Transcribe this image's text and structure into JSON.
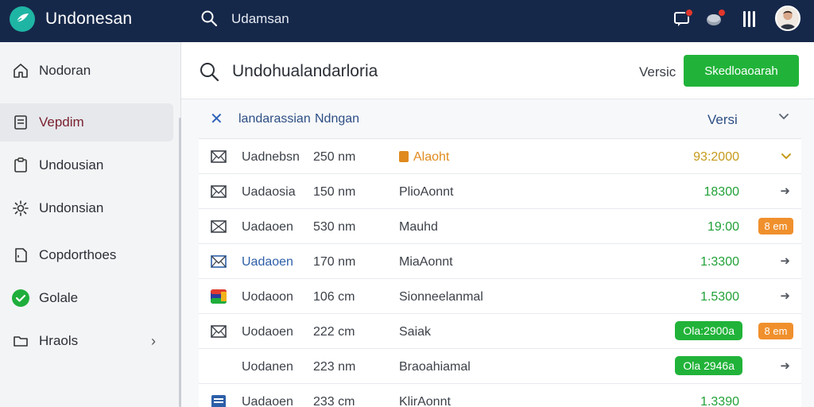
{
  "app": {
    "title": "Undonesan"
  },
  "topbar": {
    "search_text": "Udamsan"
  },
  "sidebar": {
    "items": [
      {
        "label": "Nodoran",
        "icon": "home-icon"
      },
      {
        "label": "Vepdim",
        "icon": "document-icon",
        "active": true
      },
      {
        "label": "Undousian",
        "icon": "clipboard-icon"
      },
      {
        "label": "Undonsian",
        "icon": "gear-icon"
      },
      {
        "label": "Copdorthoes",
        "icon": "file-icon"
      },
      {
        "label": "Golale",
        "icon": "check-circle-icon"
      },
      {
        "label": "Hraols",
        "icon": "folder-icon"
      }
    ]
  },
  "main": {
    "title": "Undohualandarloria",
    "version_label": "Versic",
    "primary_button": "Skedloaoarah"
  },
  "filter": {
    "left": "landarassian",
    "right": "Ndngan",
    "version": "Versi"
  },
  "rows": [
    {
      "name": "Uadnebsn",
      "size": "250 nm",
      "status": "Alaoht",
      "value": "93:2000"
    },
    {
      "name": "Uadaosia",
      "size": "150 nm",
      "status": "PlioAonnt",
      "value": "18300"
    },
    {
      "name": "Uadaoen",
      "size": "530 nm",
      "status": "Mauhd",
      "value": "19:00",
      "tag": "8 em"
    },
    {
      "name": "Uadaoen",
      "size": "170 nm",
      "status": "MiaAonnt",
      "value": "1:3300"
    },
    {
      "name": "Uodaoon",
      "size": "106 cm",
      "status": "Sionneelanmal",
      "value": "1.5300"
    },
    {
      "name": "Uodaoen",
      "size": "222 cm",
      "status": "Saiak",
      "value": "Ola:2900a",
      "tag": "8 em"
    },
    {
      "name": "Uodanen",
      "size": "223 nm",
      "status": "Braoahiamal",
      "value": "Ola 2946a"
    },
    {
      "name": "Uadaoen",
      "size": "233 cm",
      "status": "KlirAonnt",
      "value": "1.3390"
    }
  ],
  "colors": {
    "topbar": "#16284a",
    "accent_green": "#21b339",
    "tag_orange": "#f0902d",
    "link_blue": "#2d5fa8"
  }
}
